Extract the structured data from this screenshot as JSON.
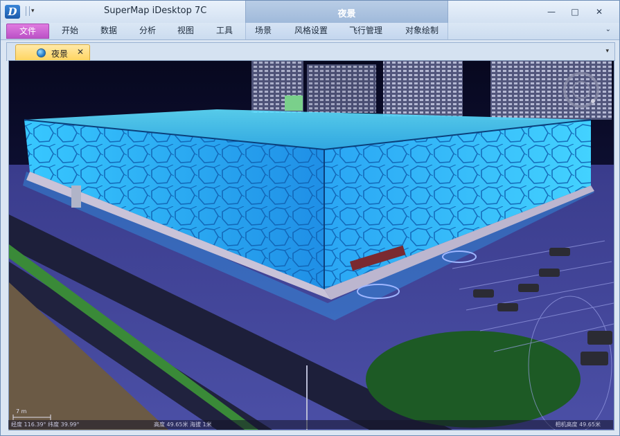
{
  "window": {
    "title": "SuperMap iDesktop 7C",
    "app_logo_letter": "D",
    "context_title": "夜景",
    "minimize_glyph": "—",
    "maximize_glyph": "□",
    "close_glyph": "✕",
    "ribbon_collapse_glyph": "⌄"
  },
  "ribbon": {
    "tabs": [
      "文件",
      "开始",
      "数据",
      "分析",
      "视图",
      "工具",
      "场景",
      "风格设置",
      "飞行管理",
      "对象绘制"
    ]
  },
  "document": {
    "tab_label": "夜景",
    "tab_close": "✕",
    "strip_dropdown": "▾"
  },
  "scene": {
    "scale_label": "7 m",
    "status_left": "经度 116.39°  纬度 39.99°",
    "status_mid": "高度 49.65米  海拔 1米",
    "status_right": "相机高度 49.65米"
  },
  "colors": {
    "file_tab": "#c45ccd",
    "doc_tab": "#ffd45e",
    "building_glow": "#2fb6ff",
    "sky": "#0d0f2e"
  }
}
